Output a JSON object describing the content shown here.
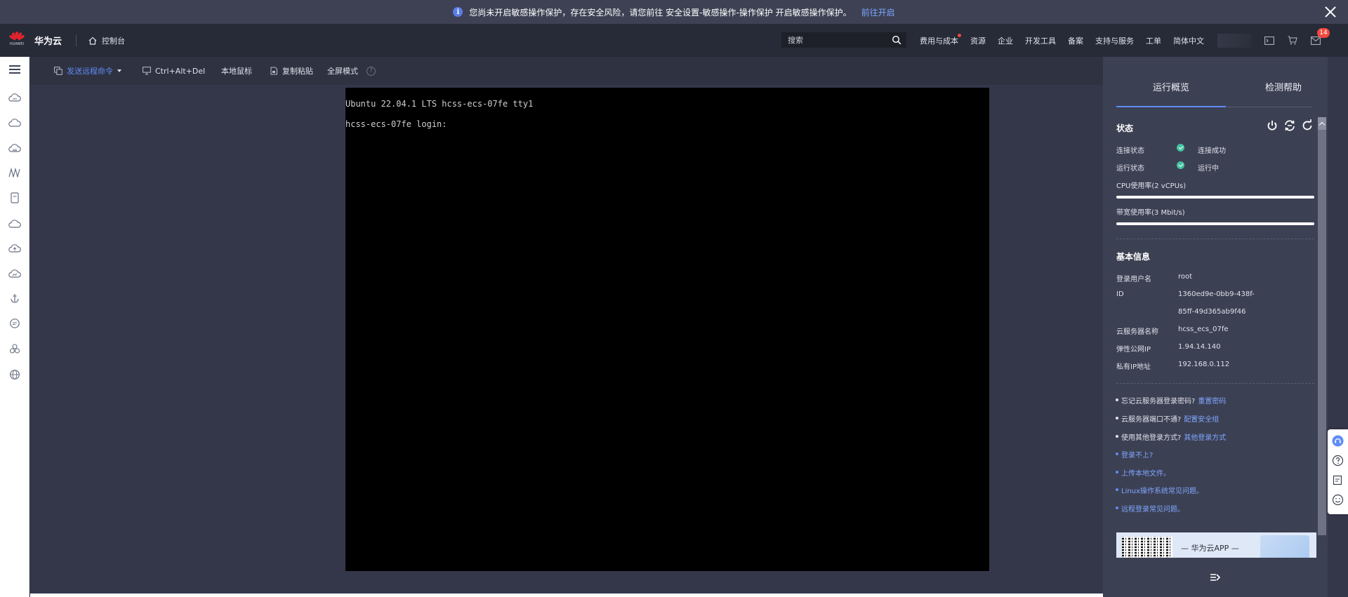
{
  "notice": {
    "text": "您尚未开启敏感操作保护，存在安全风险，请您前往 安全设置-敏感操作-操作保护 开启敏感操作保护。",
    "link": "前往开启"
  },
  "header": {
    "logo_text": "HUAWEI",
    "brand": "华为云",
    "console": "控制台",
    "search_placeholder": "搜索",
    "nav": [
      "费用与成本",
      "资源",
      "企业",
      "开发工具",
      "备案",
      "支持与服务",
      "工单",
      "简体中文"
    ],
    "message_badge": "14"
  },
  "toolbar": {
    "send_command": "发送远程命令",
    "ctrl_alt_del": "Ctrl+Alt+Del",
    "local_mouse": "本地鼠标",
    "copy_paste": "复制粘贴",
    "fullscreen": "全屏模式",
    "help": "?"
  },
  "terminal": {
    "lines": [
      "Ubuntu 22.04.1 LTS hcss-ecs-07fe tty1",
      "hcss-ecs-07fe login:"
    ]
  },
  "panel": {
    "tabs": [
      "运行概览",
      "检测帮助"
    ],
    "status": {
      "title": "状态",
      "connection_label": "连接状态",
      "connection_value": "连接成功",
      "run_label": "运行状态",
      "run_value": "运行中",
      "cpu_label": "CPU使用率(2 vCPUs)",
      "bandwidth_label": "带宽使用率(3 Mbit/s)"
    },
    "basic": {
      "title": "基本信息",
      "rows": [
        {
          "label": "登录用户名",
          "value": "root"
        },
        {
          "label": "ID",
          "value": "1360ed9e-0bb9-438f-"
        },
        {
          "label": "",
          "value": "85ff-49d365ab9f46"
        },
        {
          "label": "云服务器名称",
          "value": "hcss_ecs_07fe"
        },
        {
          "label": "弹性公网IP",
          "value": "1.94.14.140"
        },
        {
          "label": "私有IP地址",
          "value": "192.168.0.112"
        }
      ]
    },
    "help_items": [
      {
        "text": "忘记云服务器登录密码?",
        "link": "重置密码"
      },
      {
        "text": "云服务器端口不通?",
        "link": "配置安全组"
      },
      {
        "text": "使用其他登录方式?",
        "link": "其他登录方式"
      },
      {
        "text": "",
        "link": "登录不上?"
      },
      {
        "text": "",
        "link": "上传本地文件。"
      },
      {
        "text": "",
        "link": "Linux操作系统常见问题。"
      },
      {
        "text": "",
        "link": "远程登录常见问题。"
      }
    ],
    "promo": "— 华为云APP —"
  },
  "colors": {
    "accent": "#5f8cf7",
    "success": "#44c2a1",
    "badge": "#f0483e"
  }
}
